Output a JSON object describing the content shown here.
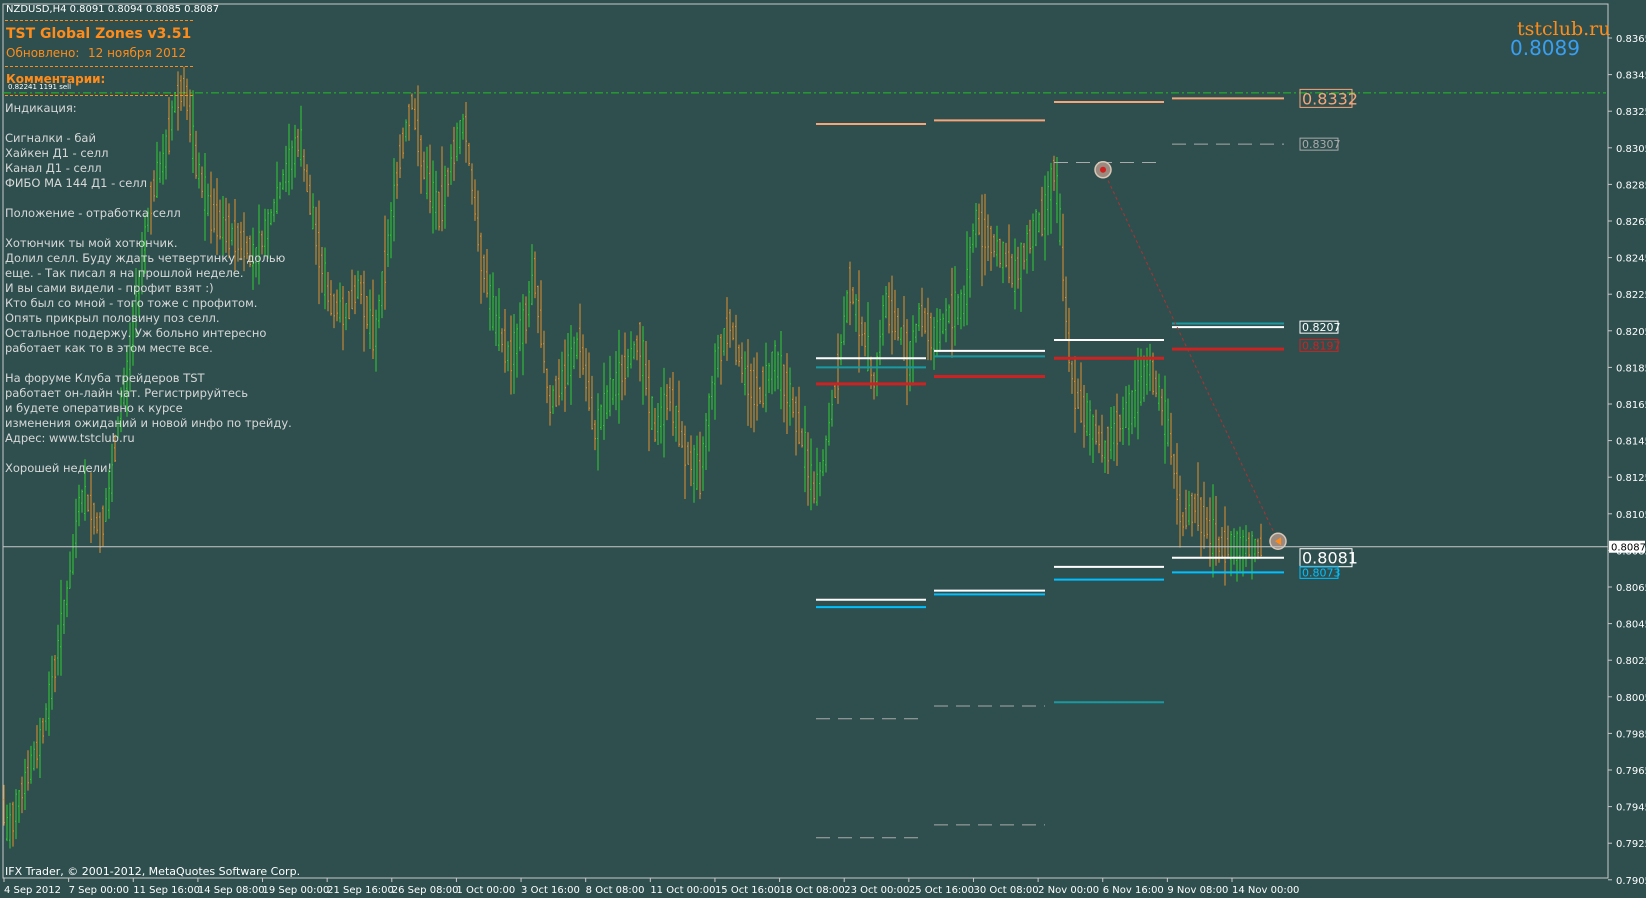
{
  "header": {
    "symbol_line": "NZDUSD,H4  0.8091 0.8094 0.8085 0.8087",
    "indicator_title": "TST Global Zones  v3.51",
    "updated_label": "Обновлено:",
    "updated_date": "12 ноября 2012",
    "comments_label": "Комментарии:",
    "small_note": "0.82241 1191 sell"
  },
  "comments": [
    "Индикация:",
    "",
    "Сигналки - бай",
    "Хайкен Д1 - селл",
    "Канал Д1 - селл",
    "ФИБО МА 144 Д1 - селл",
    "",
    "Положение - отработка селл",
    "",
    "Хотюнчик ты мой хотюнчик.",
    "Долил селл. Буду ждать четвертинку - долью",
    "еще.  - Так писал я на прошлой неделе.",
    "И вы сами видели  - профит взят :)",
    "Кто был со мной - того тоже с профитом.",
    "Опять прикрыл половину поз селл.",
    "Остальное подержу. Уж больно интересно",
    "работает как то в этом месте все.",
    "",
    "На форуме Клуба трейдеров TST",
    "работает он-лайн чат. Регистрируйтесь",
    "и будете оперативно к курсе",
    "изменения ожиданий и новой инфо по трейду.",
    "Адрес: www.tstclub.ru",
    "",
    "Хорошей недели!"
  ],
  "watermark": {
    "site": "tstclub.ru",
    "price": "0.8089"
  },
  "footer": {
    "copyright": "IFX Trader, © 2001-2012, MetaQuotes Software Corp."
  },
  "colors": {
    "background": "#2f4f4f",
    "bull": "#32cd32",
    "bear": "#e0902e",
    "accent_orange": "#ff8c1a",
    "price_blue": "#3a9ff0",
    "zone_red": "#cc2222",
    "zone_cyan": "#00c0ff",
    "zone_teal": "#1a9aa0",
    "zone_white": "#ffffff",
    "zone_salmon": "#f6a57a",
    "grid_green": "#20c020"
  },
  "chart_data": {
    "type": "candlestick",
    "symbol": "NZDUSD",
    "timeframe": "H4",
    "ohlc_last": {
      "open": 0.8091,
      "high": 0.8094,
      "low": 0.8085,
      "close": 0.8087
    },
    "current_price": 0.8087,
    "ylim": [
      0.7895,
      0.8375
    ],
    "y_ticks": [
      "0.8365",
      "0.8345",
      "0.8325",
      "0.8305",
      "0.8285",
      "0.8265",
      "0.8245",
      "0.8225",
      "0.8205",
      "0.8185",
      "0.8165",
      "0.8145",
      "0.8125",
      "0.8105",
      "0.8085",
      "0.8065",
      "0.8045",
      "0.8025",
      "0.8005",
      "0.7985",
      "0.7965",
      "0.7945",
      "0.7925",
      "0.7905"
    ],
    "x_ticks": [
      "4 Sep 2012",
      "7 Sep 00:00",
      "11 Sep 16:00",
      "14 Sep 08:00",
      "19 Sep 00:00",
      "21 Sep 16:00",
      "26 Sep 08:00",
      "1 Oct 00:00",
      "3 Oct 16:00",
      "8 Oct 08:00",
      "11 Oct 00:00",
      "15 Oct 16:00",
      "18 Oct 08:00",
      "23 Oct 00:00",
      "25 Oct 16:00",
      "30 Oct 08:00",
      "2 Nov 00:00",
      "6 Nov 16:00",
      "9 Nov 08:00",
      "14 Nov 00:00"
    ],
    "price_path": [
      [
        0,
        0.7955
      ],
      [
        8,
        0.793
      ],
      [
        18,
        0.7948
      ],
      [
        30,
        0.7965
      ],
      [
        40,
        0.798
      ],
      [
        52,
        0.801
      ],
      [
        62,
        0.8045
      ],
      [
        72,
        0.8075
      ],
      [
        80,
        0.8115
      ],
      [
        90,
        0.811
      ],
      [
        100,
        0.8095
      ],
      [
        110,
        0.8115
      ],
      [
        120,
        0.816
      ],
      [
        130,
        0.819
      ],
      [
        142,
        0.8245
      ],
      [
        152,
        0.828
      ],
      [
        165,
        0.83
      ],
      [
        175,
        0.833
      ],
      [
        185,
        0.834
      ],
      [
        195,
        0.83
      ],
      [
        210,
        0.827
      ],
      [
        225,
        0.826
      ],
      [
        240,
        0.8255
      ],
      [
        255,
        0.8245
      ],
      [
        270,
        0.8265
      ],
      [
        285,
        0.829
      ],
      [
        300,
        0.831
      ],
      [
        315,
        0.826
      ],
      [
        330,
        0.822
      ],
      [
        345,
        0.8215
      ],
      [
        360,
        0.823
      ],
      [
        375,
        0.82
      ],
      [
        385,
        0.824
      ],
      [
        400,
        0.83
      ],
      [
        412,
        0.833
      ],
      [
        425,
        0.829
      ],
      [
        440,
        0.827
      ],
      [
        455,
        0.8305
      ],
      [
        465,
        0.832
      ],
      [
        480,
        0.825
      ],
      [
        495,
        0.821
      ],
      [
        510,
        0.819
      ],
      [
        525,
        0.821
      ],
      [
        535,
        0.8235
      ],
      [
        550,
        0.8165
      ],
      [
        565,
        0.818
      ],
      [
        580,
        0.82
      ],
      [
        595,
        0.815
      ],
      [
        610,
        0.817
      ],
      [
        625,
        0.8185
      ],
      [
        640,
        0.82
      ],
      [
        655,
        0.815
      ],
      [
        670,
        0.817
      ],
      [
        685,
        0.814
      ],
      [
        700,
        0.8125
      ],
      [
        715,
        0.8185
      ],
      [
        730,
        0.821
      ],
      [
        745,
        0.818
      ],
      [
        760,
        0.817
      ],
      [
        775,
        0.819
      ],
      [
        790,
        0.817
      ],
      [
        805,
        0.814
      ],
      [
        815,
        0.8115
      ],
      [
        825,
        0.8135
      ],
      [
        840,
        0.819
      ],
      [
        850,
        0.823
      ],
      [
        865,
        0.82
      ],
      [
        875,
        0.8175
      ],
      [
        885,
        0.822
      ],
      [
        900,
        0.8205
      ],
      [
        910,
        0.819
      ],
      [
        920,
        0.8215
      ],
      [
        935,
        0.82
      ],
      [
        950,
        0.8215
      ],
      [
        965,
        0.822
      ],
      [
        975,
        0.8265
      ],
      [
        990,
        0.8255
      ],
      [
        1005,
        0.8245
      ],
      [
        1015,
        0.8235
      ],
      [
        1030,
        0.8255
      ],
      [
        1045,
        0.827
      ],
      [
        1055,
        0.8295
      ],
      [
        1062,
        0.825
      ],
      [
        1068,
        0.82
      ],
      [
        1075,
        0.817
      ],
      [
        1090,
        0.8155
      ],
      [
        1105,
        0.814
      ],
      [
        1120,
        0.8155
      ],
      [
        1135,
        0.8165
      ],
      [
        1150,
        0.8185
      ],
      [
        1162,
        0.8165
      ],
      [
        1172,
        0.814
      ],
      [
        1182,
        0.81
      ],
      [
        1195,
        0.811
      ],
      [
        1210,
        0.8095
      ],
      [
        1220,
        0.8087
      ]
    ],
    "zones": [
      {
        "x1": 816,
        "x2": 926,
        "y": 0.8318,
        "color": "#f6a57a",
        "style": "solid"
      },
      {
        "x1": 934,
        "x2": 1045,
        "y": 0.832,
        "color": "#f6a57a",
        "style": "solid"
      },
      {
        "x1": 1054,
        "x2": 1164,
        "y": 0.833,
        "color": "#f6a57a",
        "style": "solid"
      },
      {
        "x1": 1172,
        "x2": 1284,
        "y": 0.8332,
        "color": "#f6a57a",
        "style": "solid"
      },
      {
        "x1": 1054,
        "x2": 1164,
        "y": 0.8297,
        "color": "#aaaaaa",
        "style": "dash"
      },
      {
        "x1": 1172,
        "x2": 1284,
        "y": 0.8307,
        "color": "#aaaaaa",
        "style": "dash"
      },
      {
        "x1": 816,
        "x2": 926,
        "y": 0.819,
        "color": "#ffffff",
        "style": "solid"
      },
      {
        "x1": 816,
        "x2": 926,
        "y": 0.8185,
        "color": "#1a9aa0",
        "style": "solid"
      },
      {
        "x1": 816,
        "x2": 926,
        "y": 0.8176,
        "color": "#cc2222",
        "style": "thick"
      },
      {
        "x1": 934,
        "x2": 1045,
        "y": 0.8194,
        "color": "#ffffff",
        "style": "solid"
      },
      {
        "x1": 934,
        "x2": 1045,
        "y": 0.8191,
        "color": "#1a9aa0",
        "style": "solid"
      },
      {
        "x1": 934,
        "x2": 1045,
        "y": 0.818,
        "color": "#cc2222",
        "style": "thick"
      },
      {
        "x1": 1054,
        "x2": 1164,
        "y": 0.82,
        "color": "#ffffff",
        "style": "solid"
      },
      {
        "x1": 1054,
        "x2": 1164,
        "y": 0.819,
        "color": "#cc2222",
        "style": "thick"
      },
      {
        "x1": 1172,
        "x2": 1284,
        "y": 0.8209,
        "color": "#1a9aa0",
        "style": "solid"
      },
      {
        "x1": 1172,
        "x2": 1284,
        "y": 0.8207,
        "color": "#ffffff",
        "style": "solid"
      },
      {
        "x1": 1172,
        "x2": 1284,
        "y": 0.8195,
        "color": "#cc2222",
        "style": "thick"
      },
      {
        "x1": 1172,
        "x2": 1284,
        "y": 0.8081,
        "color": "#ffffff",
        "style": "solid"
      },
      {
        "x1": 1172,
        "x2": 1284,
        "y": 0.8073,
        "color": "#00c0ff",
        "style": "solid"
      },
      {
        "x1": 1054,
        "x2": 1164,
        "y": 0.8076,
        "color": "#ffffff",
        "style": "solid"
      },
      {
        "x1": 1054,
        "x2": 1164,
        "y": 0.8069,
        "color": "#00c0ff",
        "style": "solid"
      },
      {
        "x1": 934,
        "x2": 1045,
        "y": 0.8063,
        "color": "#ffffff",
        "style": "solid"
      },
      {
        "x1": 934,
        "x2": 1045,
        "y": 0.8061,
        "color": "#00c0ff",
        "style": "solid"
      },
      {
        "x1": 816,
        "x2": 926,
        "y": 0.8058,
        "color": "#ffffff",
        "style": "solid"
      },
      {
        "x1": 816,
        "x2": 926,
        "y": 0.8054,
        "color": "#00c0ff",
        "style": "solid"
      },
      {
        "x1": 1054,
        "x2": 1164,
        "y": 0.8002,
        "color": "#1a9aa0",
        "style": "solid"
      },
      {
        "x1": 934,
        "x2": 1045,
        "y": 0.8,
        "color": "#aaaaaa",
        "style": "dash"
      },
      {
        "x1": 816,
        "x2": 926,
        "y": 0.7993,
        "color": "#aaaaaa",
        "style": "dash"
      },
      {
        "x1": 934,
        "x2": 1045,
        "y": 0.7935,
        "color": "#aaaaaa",
        "style": "dash"
      },
      {
        "x1": 816,
        "x2": 926,
        "y": 0.7928,
        "color": "#aaaaaa",
        "style": "dash"
      }
    ],
    "level_labels": [
      {
        "x": 1300,
        "y": 0.8332,
        "text": "0.8332",
        "color": "#f6a57a",
        "size": "big"
      },
      {
        "x": 1300,
        "y": 0.8307,
        "text": "0.8307",
        "color": "#aaaaaa",
        "size": "small"
      },
      {
        "x": 1300,
        "y": 0.8207,
        "text": "0.8207",
        "color": "#ffffff",
        "size": "small"
      },
      {
        "x": 1300,
        "y": 0.8197,
        "text": "0.8197",
        "color": "#cc2222",
        "size": "small"
      },
      {
        "x": 1300,
        "y": 0.8081,
        "text": "0.8081",
        "color": "#ffffff",
        "size": "big"
      },
      {
        "x": 1300,
        "y": 0.8073,
        "text": "0.8073",
        "color": "#00c0ff",
        "size": "small"
      }
    ],
    "green_dashdot_level": 0.8335,
    "markers": [
      {
        "x": 1103,
        "y": 0.8293,
        "kind": "sell-entry"
      },
      {
        "x": 1278,
        "y": 0.809,
        "kind": "exit"
      }
    ],
    "trade_line": [
      [
        1103,
        0.8293
      ],
      [
        1278,
        0.809
      ]
    ]
  }
}
